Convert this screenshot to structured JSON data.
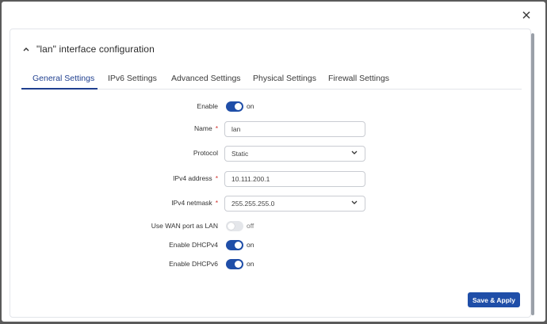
{
  "dialog": {
    "section_title": "\"lan\" interface configuration",
    "save_label": "Save & Apply"
  },
  "tabs": [
    {
      "label": "General Settings",
      "active": true
    },
    {
      "label": "IPv6 Settings",
      "active": false
    },
    {
      "label": "Advanced Settings",
      "active": false
    },
    {
      "label": "Physical Settings",
      "active": false
    },
    {
      "label": "Firewall Settings",
      "active": false
    }
  ],
  "form": {
    "enable": {
      "label": "Enable",
      "state": "on"
    },
    "name": {
      "label": "Name",
      "required": "*",
      "value": "lan"
    },
    "protocol": {
      "label": "Protocol",
      "value": "Static"
    },
    "ipv4_address": {
      "label": "IPv4 address",
      "required": "*",
      "value": "10.111.200.1"
    },
    "ipv4_netmask": {
      "label": "IPv4 netmask",
      "required": "*",
      "value": "255.255.255.0"
    },
    "wan_as_lan": {
      "label": "Use WAN port as LAN",
      "state": "off"
    },
    "dhcpv4": {
      "label": "Enable DHCPv4",
      "state": "on"
    },
    "dhcpv6": {
      "label": "Enable DHCPv6",
      "state": "on"
    }
  },
  "colors": {
    "accent": "#1f4ea8",
    "required": "#d0312d",
    "overlay": "#5a5a5a"
  },
  "icons": {
    "close": "close-icon",
    "collapse": "chevron-up-icon",
    "dropdown": "chevron-down-icon"
  }
}
